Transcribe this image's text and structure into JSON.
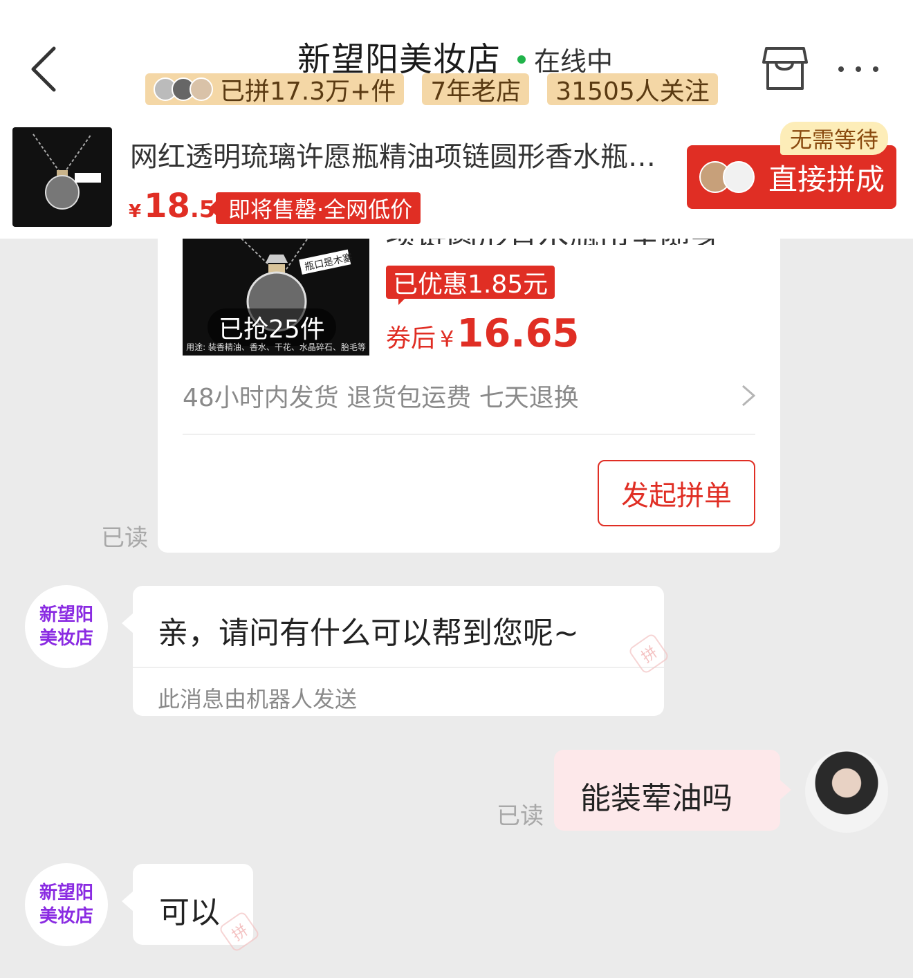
{
  "header": {
    "shop_name": "新望阳美妆店",
    "status": "在线中",
    "tags": [
      "已拼17.3万+件",
      "7年老店",
      "31505人关注"
    ]
  },
  "product": {
    "title": "网红透明琉璃许愿瓶精油项链圆形香水瓶吊坠随身",
    "price_symbol": "¥",
    "price_int": "18",
    "price_dec": ".5",
    "promo": "即将售罄·全网低价",
    "direct_badge": "无需等待",
    "direct_button": "直接拼成"
  },
  "card": {
    "title_fragment": "项链圆形香水瓶吊坠随身",
    "grabbed": "已抢25件",
    "image_usage_text": "用途: 装香精油、香水、干花、水晶碎石、胎毛等",
    "image_label": "瓶口是木塞",
    "discount": "已优惠1.85元",
    "after_coupon_label": "券后",
    "after_coupon_symbol": "¥",
    "after_coupon_value": "16.65",
    "services": "48小时内发货 退货包运费 七天退换",
    "start_button": "发起拼单",
    "read": "已读"
  },
  "messages": {
    "shop_avatar_line1": "新望阳",
    "shop_avatar_line2": "美妆店",
    "greeting": "亲，请问有什么可以帮到您呢~",
    "robot_note": "此消息由机器人发送",
    "user_msg": "能装荤油吗",
    "user_read": "已读",
    "reply": "可以",
    "stamp": "拼"
  },
  "colors": {
    "accent": "#e02e24",
    "tag_bg": "#f4d7a6",
    "user_bubble": "#fde8ea",
    "online_dot": "#20b34a"
  }
}
